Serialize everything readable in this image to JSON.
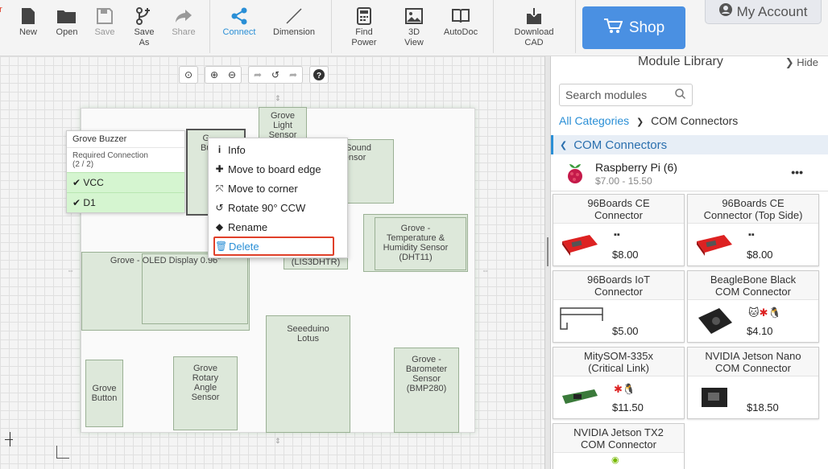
{
  "toolbar": {
    "new": "New",
    "open": "Open",
    "save": "Save",
    "save_as": "Save\nAs",
    "share": "Share",
    "connect": "Connect",
    "dimension": "Dimension",
    "find_power": "Find\nPower",
    "view3d": "3D\nView",
    "autodoc": "AutoDoc",
    "download_cad": "Download\nCAD",
    "shop": "Shop",
    "account": "My Account"
  },
  "canvas": {
    "modules": {
      "light_sensor": "Grove\nLight\nSensor",
      "sound_sensor": "e Sound\nensor",
      "buzzer_partial": "G\nBu",
      "temp_humidity": "Grove -\nTemperature &\nHumidity Sensor\n(DHT11)",
      "accel_partial": "Accelerom\n(LIS3DHTR)",
      "oled": "Grove - OLED Display 0.96\"",
      "seeeduino": "Seeeduino\nLotus",
      "button": "Grove\nButton",
      "rotary": "Grove\nRotary\nAngle\nSensor",
      "barometer": "Grove -\nBarometer\nSensor\n(BMP280)"
    }
  },
  "conn_popup": {
    "title": "Grove Buzzer",
    "subtitle": "Required Connection\n(2 / 2)",
    "pins": [
      "VCC",
      "D1"
    ]
  },
  "context_menu": {
    "items": [
      "Info",
      "Move to board edge",
      "Move to corner",
      "Rotate 90° CCW",
      "Rename",
      "Delete"
    ]
  },
  "library": {
    "title": "Module Library",
    "hide": "Hide",
    "search_placeholder": "Search modules",
    "crumb_root": "All Categories",
    "crumb_current": "COM Connectors",
    "category": "COM Connectors",
    "featured": {
      "name": "Raspberry Pi (6)",
      "price": "$7.00 - 15.50"
    },
    "cards": [
      {
        "title": "96Boards CE\nConnector",
        "price": "$8.00"
      },
      {
        "title": "96Boards CE\nConnector (Top Side)",
        "price": "$8.00"
      },
      {
        "title": "96Boards IoT\nConnector",
        "price": "$5.00"
      },
      {
        "title": "BeagleBone Black\nCOM Connector",
        "price": "$4.10"
      },
      {
        "title": "MitySOM-335x\n(Critical Link)",
        "price": "$11.50"
      },
      {
        "title": "NVIDIA Jetson Nano\nCOM Connector",
        "price": "$18.50"
      },
      {
        "title": "NVIDIA Jetson TX2\nCOM Connector",
        "price": ""
      }
    ]
  },
  "colors": {
    "accent": "#2a8fd6",
    "shop": "#4a90e2",
    "module_fill": "#dde8da",
    "connected_pin": "#d5f5d0",
    "highlight": "#e0402a"
  }
}
